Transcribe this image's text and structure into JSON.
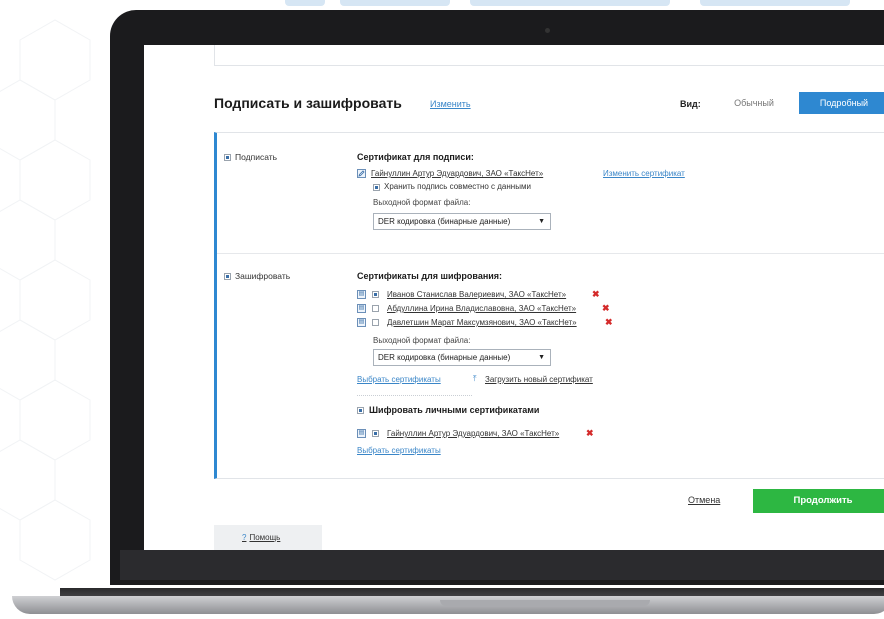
{
  "header": {
    "title": "Подписать и зашифровать",
    "change_link": "Изменить",
    "view_label": "Вид:",
    "view_simple": "Обычный",
    "view_detailed": "Подробный"
  },
  "sign": {
    "checkbox_label": "Подписать",
    "checked": true,
    "section_title": "Сертификат для подписи:",
    "certificate": "Гайнуллин Артур Эдуардович, ЗАО «ТаксНет»",
    "change_certificate": "Изменить сертификат",
    "keep_together_label": "Хранить подпись совместно с данными",
    "keep_together_checked": true,
    "format_label": "Выходной формат файла:",
    "format_value": "DER кодировка (бинарные данные)"
  },
  "encrypt": {
    "checkbox_label": "Зашифровать",
    "checked": true,
    "section_title": "Сертификаты для шифрования:",
    "certificates": [
      {
        "name": "Иванов Станислав Валериевич, ЗАО «ТаксНет»",
        "checked": true
      },
      {
        "name": "Абдуллина Ирина Владиславовна, ЗАО «ТаксНет»",
        "checked": false
      },
      {
        "name": "Давлетшин Марат Максумзянович, ЗАО «ТаксНет»",
        "checked": false
      }
    ],
    "format_label": "Выходной формат файла:",
    "format_value": "DER кодировка (бинарные данные)",
    "choose_certificates": "Выбрать сертификаты",
    "upload_certificate": "Загрузить новый сертификат",
    "personal_label": "Шифровать личными сертификатами",
    "personal_checked": true,
    "personal_certificates": [
      {
        "name": "Гайнуллин Артур Эдуардович, ЗАО «ТаксНет»",
        "checked": true
      }
    ],
    "personal_choose": "Выбрать сертификаты"
  },
  "footer": {
    "cancel": "Отмена",
    "continue": "Продолжить",
    "help": "Помощь",
    "help_icon": "?"
  },
  "colors": {
    "accent_blue": "#2e88d1",
    "link_blue": "#3a86c8",
    "continue_green": "#2db742",
    "remove_red": "#d42a2a"
  }
}
